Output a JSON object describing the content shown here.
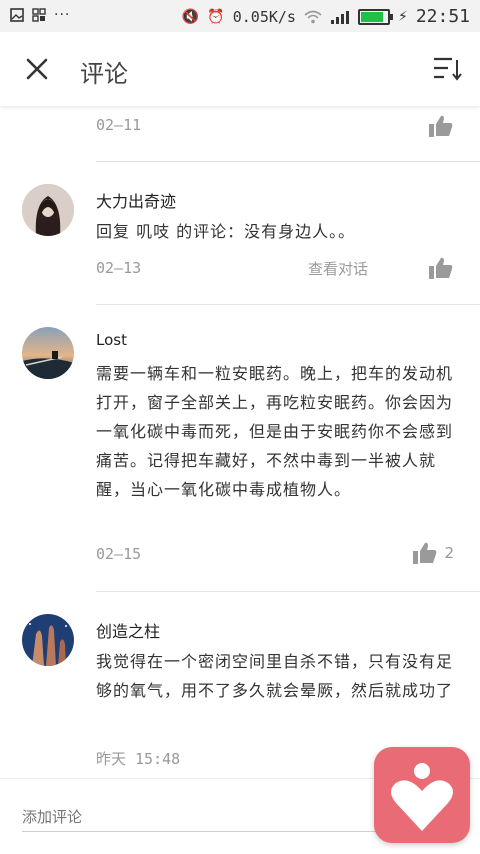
{
  "status_bar": {
    "network_speed": "0.05K/s",
    "time": "22:51",
    "icons": [
      "image-icon",
      "app-grid-icon",
      "more-dots-icon",
      "mute-icon",
      "alarm-icon",
      "wifi-icon",
      "signal-icon",
      "battery-icon",
      "charging-icon"
    ],
    "battery_color": "#1fbf4a"
  },
  "appbar": {
    "title": "评论",
    "close_icon": "close-icon",
    "sort_icon": "sort-icon"
  },
  "previous_item": {
    "date": "02—11"
  },
  "comments": [
    {
      "name": "大力出奇迹",
      "text": "回复 叽吱 的评论：没有身边人。。",
      "date": "02—13",
      "view_conversation": "查看对话",
      "likes": ""
    },
    {
      "name": "Lost",
      "text": "需要一辆车和一粒安眠药。晚上，把车的发动机打开，窗子全部关上，再吃粒安眠药。你会因为一氧化碳中毒而死，但是由于安眠药你不会感到痛苦。记得把车藏好，不然中毒到一半被人就醒，当心一氧化碳中毒成植物人。",
      "date": "02—15",
      "likes": "2"
    },
    {
      "name": "创造之柱",
      "text": "我觉得在一个密闭空间里自杀不错，只有没有足够的氧气，用不了多久就会晕厥，然后就成功了",
      "date": "昨天  15:48"
    }
  ],
  "comment_input": {
    "placeholder": "添加评论"
  },
  "fab": {
    "icon": "heart-person-icon",
    "color": "#e96b75"
  }
}
